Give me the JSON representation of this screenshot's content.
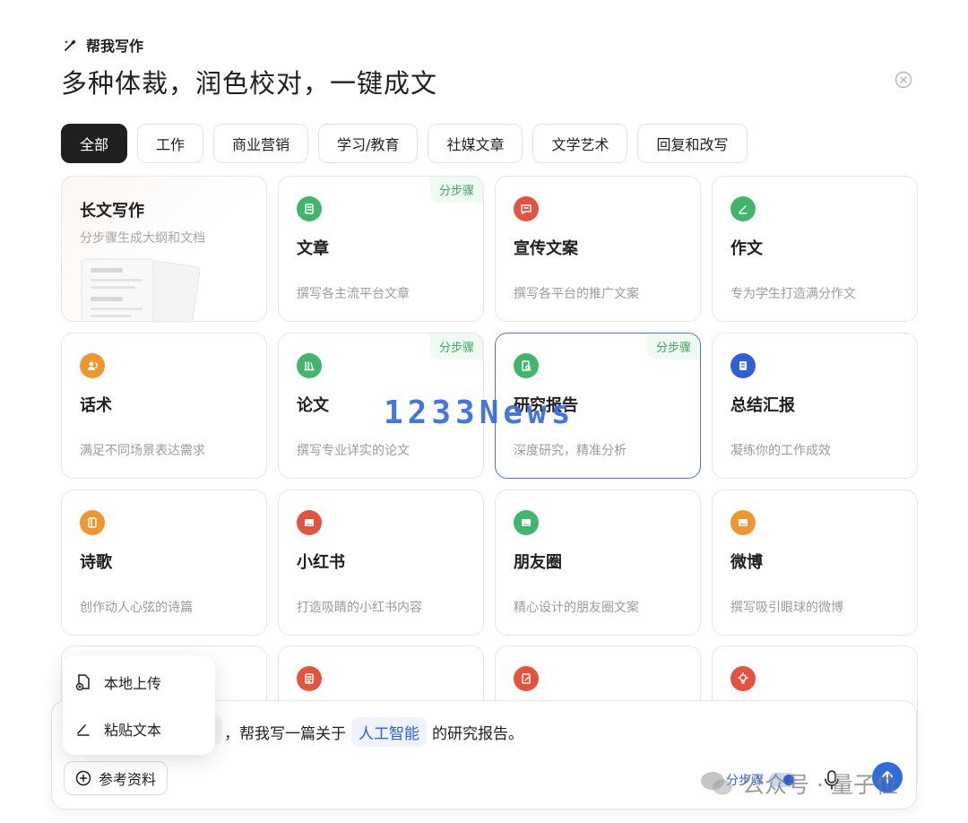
{
  "header": {
    "label": "帮我写作",
    "title": "多种体裁，润色校对，一键成文",
    "label_icon": "magic-pen-icon",
    "close_icon": "close-circle-icon"
  },
  "tabs": [
    "全部",
    "工作",
    "商业营销",
    "学习/教育",
    "社媒文章",
    "文学艺术",
    "回复和改写"
  ],
  "active_tab": "全部",
  "cards": [
    {
      "title": "长文写作",
      "desc": "分步骤生成大纲和文档",
      "featured": true
    },
    {
      "title": "文章",
      "desc": "撰写各主流平台文章",
      "badge": "分步骤",
      "icon": "article-icon",
      "color": "#3fb66b"
    },
    {
      "title": "宣传文案",
      "desc": "撰写各平台的推广文案",
      "icon": "chat-bubble-icon",
      "color": "#e5533f"
    },
    {
      "title": "作文",
      "desc": "专为学生打造满分作文",
      "icon": "pen-icon",
      "color": "#3fb66b"
    },
    {
      "title": "话术",
      "desc": "满足不同场景表达需求",
      "icon": "speaker-icon",
      "color": "#f0962e"
    },
    {
      "title": "论文",
      "desc": "撰写专业详实的论文",
      "badge": "分步骤",
      "icon": "books-icon",
      "color": "#3fb66b"
    },
    {
      "title": "研究报告",
      "desc": "深度研究，精准分析",
      "badge": "分步骤",
      "icon": "report-search-icon",
      "color": "#3fb66b",
      "selected": true
    },
    {
      "title": "总结汇报",
      "desc": "凝练你的工作成效",
      "icon": "notebook-icon",
      "color": "#2f5fd9"
    },
    {
      "title": "诗歌",
      "desc": "创作动人心弦的诗篇",
      "icon": "book-icon",
      "color": "#f0962e"
    },
    {
      "title": "小红书",
      "desc": "打造吸睛的小红书内容",
      "icon": "image-card-icon",
      "color": "#e5533f"
    },
    {
      "title": "朋友圈",
      "desc": "精心设计的朋友圈文案",
      "icon": "image-card-icon",
      "color": "#3fb66b"
    },
    {
      "title": "微博",
      "desc": "撰写吸引眼球的微博",
      "icon": "image-card-icon",
      "color": "#f0962e"
    },
    {
      "title": "",
      "desc": "",
      "icon": "blank-card-icon",
      "color": "#3fb66b"
    },
    {
      "title": "",
      "desc": "",
      "icon": "list-doc-icon",
      "color": "#e5533f"
    },
    {
      "title": "",
      "desc": "",
      "icon": "edit-doc-icon",
      "color": "#e5533f"
    },
    {
      "title": "",
      "desc": "",
      "icon": "bulb-icon",
      "color": "#e5533f"
    }
  ],
  "watermark": "1233News",
  "composer": {
    "prompt_prefix": "，帮我写一篇关于",
    "prompt_chip": "人工智能",
    "prompt_suffix": "的研究报告。",
    "ref_button": "参考资料",
    "step_toggle": "分步骤",
    "send_icon": "arrow-up-icon",
    "mic_icon": "mic-icon"
  },
  "popup": {
    "items": [
      {
        "label": "本地上传",
        "icon": "upload-file-icon"
      },
      {
        "label": "粘贴文本",
        "icon": "pen-line-icon"
      }
    ]
  },
  "wechat_mark": "公众号 · 量子位"
}
